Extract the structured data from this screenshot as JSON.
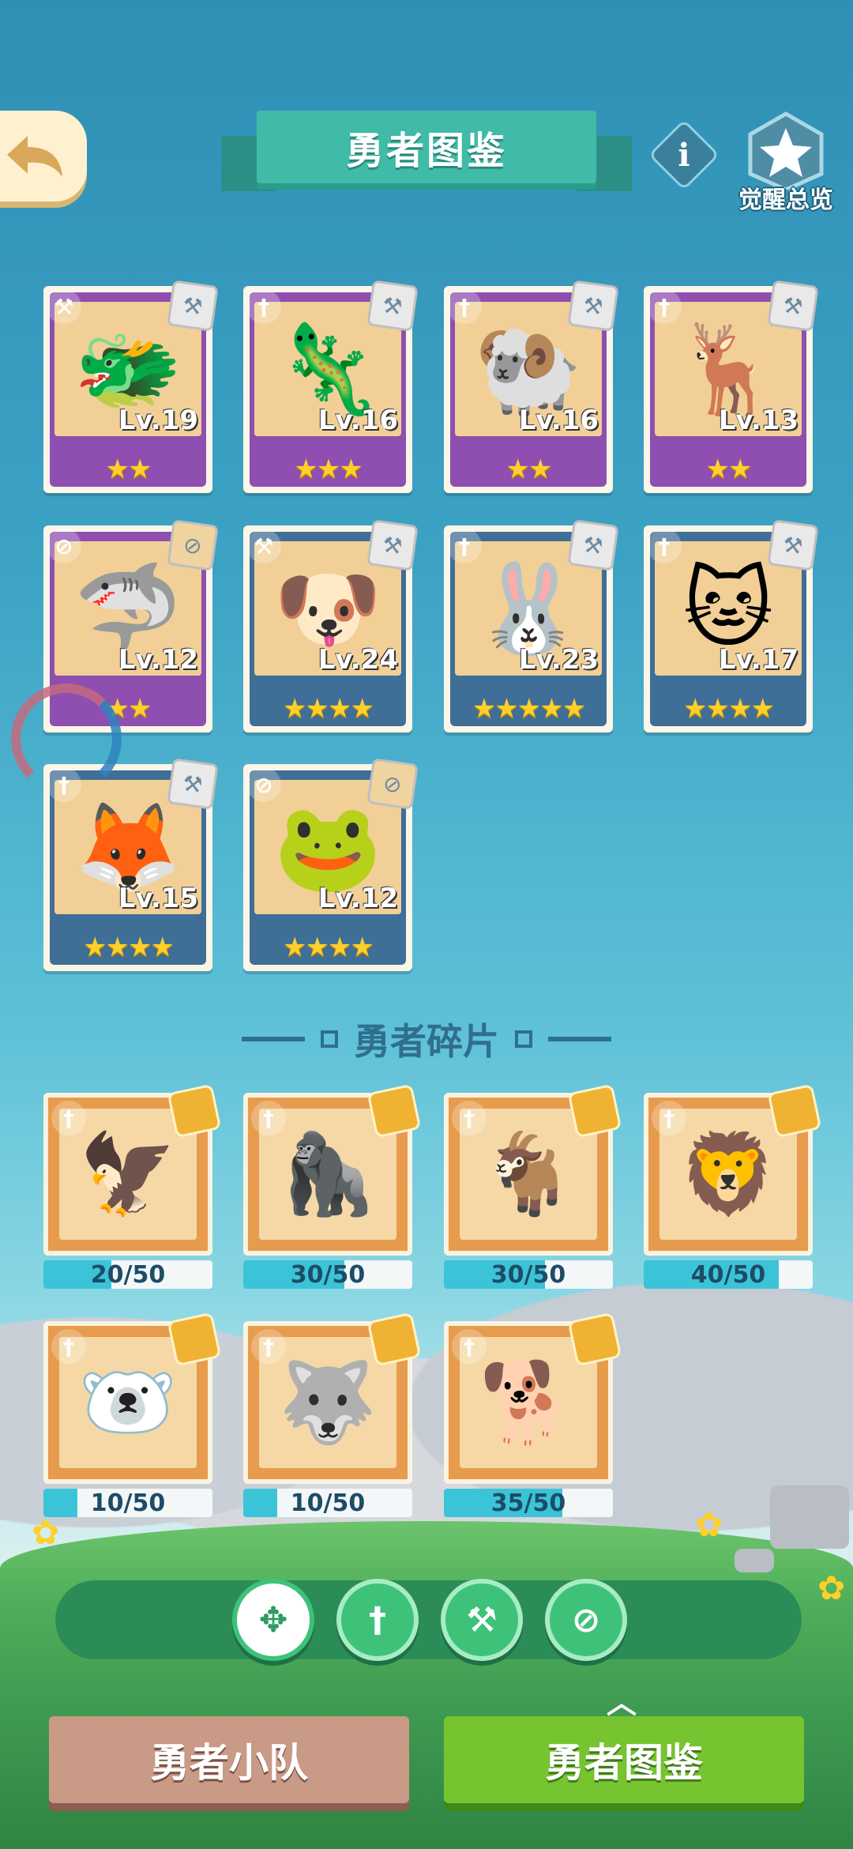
{
  "header": {
    "title": "勇者图鉴",
    "awaken_label": "觉醒总览"
  },
  "heroes": [
    {
      "level": "Lv.19",
      "stars": "★★",
      "rarity": "purple",
      "cls": "hammer",
      "emoji": "🐲",
      "bg": "#f1cf96"
    },
    {
      "level": "Lv.16",
      "stars": "★★★",
      "rarity": "purple",
      "cls": "sword",
      "emoji": "🦎",
      "bg": "#f1cf96"
    },
    {
      "level": "Lv.16",
      "stars": "★★",
      "rarity": "purple",
      "cls": "sword",
      "emoji": "🐏",
      "bg": "#f1cf96"
    },
    {
      "level": "Lv.13",
      "stars": "★★",
      "rarity": "purple",
      "cls": "sword",
      "emoji": "🦌",
      "bg": "#f1cf96"
    },
    {
      "level": "Lv.12",
      "stars": "★★",
      "rarity": "purple",
      "cls": "compass",
      "emoji": "🦈",
      "bg": "#f1cf96"
    },
    {
      "level": "Lv.24",
      "stars": "★★★★",
      "rarity": "blue",
      "cls": "hammer",
      "emoji": "🐶",
      "bg": "#f1cf96"
    },
    {
      "level": "Lv.23",
      "stars": "★★★★★",
      "rarity": "blue",
      "cls": "sword",
      "emoji": "🐰",
      "bg": "#f1cf96"
    },
    {
      "level": "Lv.17",
      "stars": "★★★★",
      "rarity": "blue",
      "cls": "sword",
      "emoji": "🐱",
      "bg": "#f1cf96"
    },
    {
      "level": "Lv.15",
      "stars": "★★★★",
      "rarity": "blue",
      "cls": "sword",
      "emoji": "🦊",
      "bg": "#f1cf96"
    },
    {
      "level": "Lv.12",
      "stars": "★★★★",
      "rarity": "blue",
      "cls": "compass",
      "emoji": "🐸",
      "bg": "#f1cf96"
    }
  ],
  "fragments_title": "勇者碎片",
  "fragments": [
    {
      "progress": "20/50",
      "value": 20,
      "max": 50,
      "emoji": "🦅"
    },
    {
      "progress": "30/50",
      "value": 30,
      "max": 50,
      "emoji": "🦍"
    },
    {
      "progress": "30/50",
      "value": 30,
      "max": 50,
      "emoji": "🐐"
    },
    {
      "progress": "40/50",
      "value": 40,
      "max": 50,
      "emoji": "🦁"
    },
    {
      "progress": "10/50",
      "value": 10,
      "max": 50,
      "emoji": "🐻‍❄️"
    },
    {
      "progress": "10/50",
      "value": 10,
      "max": 50,
      "emoji": "🐺"
    },
    {
      "progress": "35/50",
      "value": 35,
      "max": 50,
      "emoji": "🐕"
    }
  ],
  "filters": [
    {
      "icon": "all-icon",
      "glyph": "✥",
      "active": true
    },
    {
      "icon": "sword-icon",
      "glyph": "†",
      "active": false
    },
    {
      "icon": "hammer-icon",
      "glyph": "⚒",
      "active": false
    },
    {
      "icon": "compass-icon",
      "glyph": "⊘",
      "active": false
    }
  ],
  "tabs": {
    "team": "勇者小队",
    "dex": "勇者图鉴"
  },
  "colors": {
    "purple_frame": "#8e4fb1",
    "blue_frame": "#3f6e96",
    "fragment_fill": "#3bc4d8",
    "star": "#ffcf2b",
    "dex_tab": "#76c42f"
  }
}
